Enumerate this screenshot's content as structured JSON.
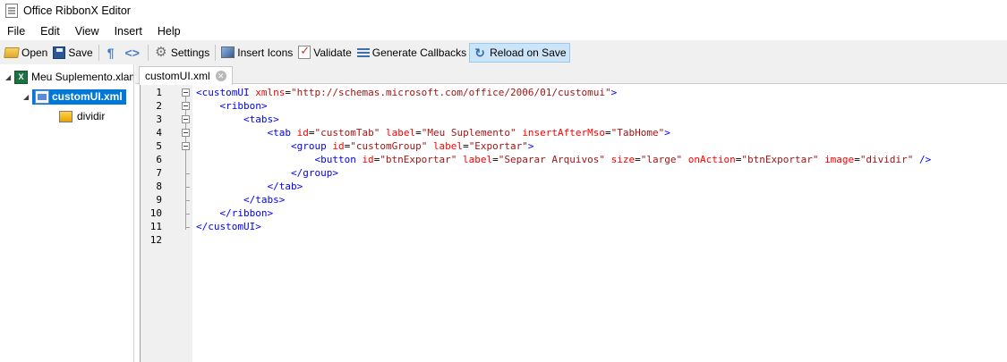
{
  "window": {
    "title": "Office RibbonX Editor"
  },
  "menu": [
    "File",
    "Edit",
    "View",
    "Insert",
    "Help"
  ],
  "toolbar": {
    "open": "Open",
    "save": "Save",
    "pilcrow": "¶",
    "code": "<>",
    "settings": "Settings",
    "insert_icons": "Insert Icons",
    "validate": "Validate",
    "generate_callbacks": "Generate Callbacks",
    "reload_on_save": "Reload on Save"
  },
  "tree": {
    "root_label": "Meu Suplemento.xlam",
    "child_label": "customUI.xml",
    "image_label": "dividir"
  },
  "editor": {
    "tab_label": "customUI.xml",
    "line_numbers": [
      "1",
      "2",
      "3",
      "4",
      "5",
      "6",
      "7",
      "8",
      "9",
      "10",
      "11",
      "12"
    ],
    "lines": {
      "l1": {
        "tag": "<customUI",
        "a1": "xmlns",
        "v1": "\"http://schemas.microsoft.com/office/2006/01/customui\"",
        "end": ">"
      },
      "l2": {
        "tag": "<ribbon>"
      },
      "l3": {
        "tag": "<tabs>"
      },
      "l4": {
        "tag": "<tab",
        "a1": "id",
        "v1": "\"customTab\"",
        "a2": "label",
        "v2": "\"Meu Suplemento\"",
        "a3": "insertAfterMso",
        "v3": "\"TabHome\"",
        "end": ">"
      },
      "l5": {
        "tag": "<group",
        "a1": "id",
        "v1": "\"customGroup\"",
        "a2": "label",
        "v2": "\"Exportar\"",
        "end": ">"
      },
      "l6": {
        "tag": "<button",
        "a1": "id",
        "v1": "\"btnExportar\"",
        "a2": "label",
        "v2": "\"Separar Arquivos\"",
        "a3": "size",
        "v3": "\"large\"",
        "a4": "onAction",
        "v4": "\"btnExportar\"",
        "a5": "image",
        "v5": "\"dividir\"",
        "end": "/>"
      },
      "l7": {
        "tag": "</group>"
      },
      "l8": {
        "tag": "</tab>"
      },
      "l9": {
        "tag": "</tabs>"
      },
      "l10": {
        "tag": "</ribbon>"
      },
      "l11": {
        "tag": "</customUI>"
      }
    }
  }
}
